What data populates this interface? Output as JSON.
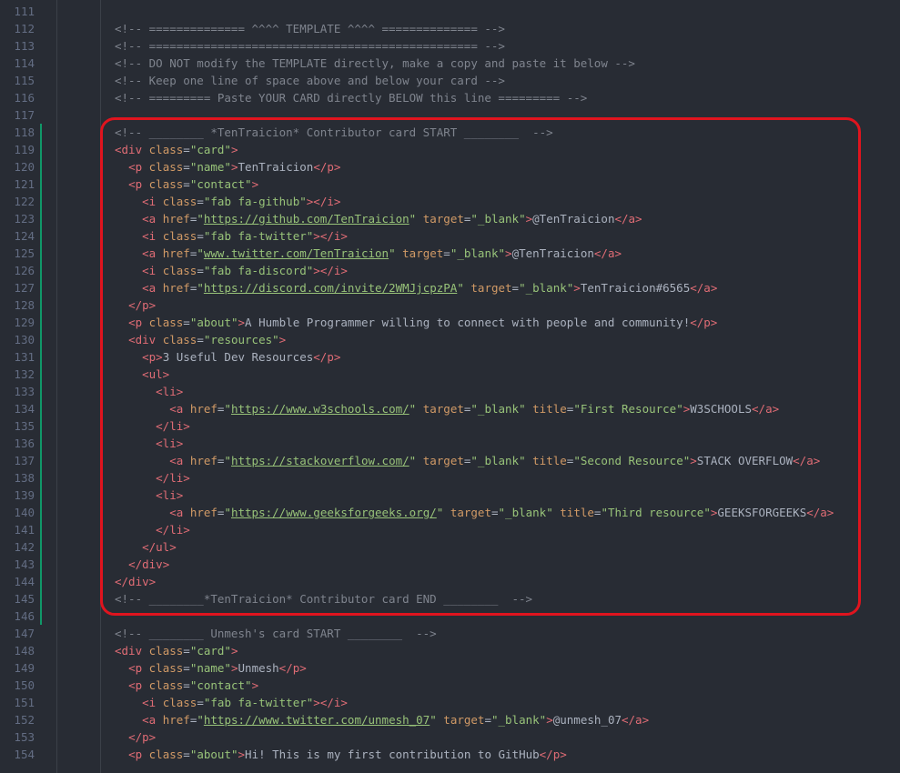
{
  "editor": {
    "lines": [
      {
        "n": "111",
        "mod": false,
        "parts": []
      },
      {
        "n": "112",
        "mod": false,
        "parts": [
          [
            "c",
            "<!-- ============== ^^^^ TEMPLATE ^^^^ ============== -->"
          ]
        ]
      },
      {
        "n": "113",
        "mod": false,
        "parts": [
          [
            "c",
            "<!-- ================================================ -->"
          ]
        ]
      },
      {
        "n": "114",
        "mod": false,
        "parts": [
          [
            "c",
            "<!-- DO NOT modify the TEMPLATE directly, make a copy and paste it below -->"
          ]
        ]
      },
      {
        "n": "115",
        "mod": false,
        "parts": [
          [
            "c",
            "<!-- Keep one line of space above and below your card -->"
          ]
        ]
      },
      {
        "n": "116",
        "mod": false,
        "parts": [
          [
            "c",
            "<!-- ========= Paste YOUR CARD directly BELOW this line ========= -->"
          ]
        ]
      },
      {
        "n": "117",
        "mod": false,
        "parts": []
      },
      {
        "n": "118",
        "mod": true,
        "parts": [
          [
            "c",
            "<!-- ________ *TenTraicion* Contributor card START ________  -->"
          ]
        ]
      },
      {
        "n": "119",
        "mod": true,
        "parts": [
          [
            "t",
            "<div"
          ],
          [
            "x",
            " "
          ],
          [
            "a",
            "class"
          ],
          [
            "p",
            "="
          ],
          [
            "s",
            "\"card\""
          ],
          [
            "t",
            ">"
          ]
        ]
      },
      {
        "n": "120",
        "mod": true,
        "parts": [
          [
            "x",
            "  "
          ],
          [
            "t",
            "<p"
          ],
          [
            "x",
            " "
          ],
          [
            "a",
            "class"
          ],
          [
            "p",
            "="
          ],
          [
            "s",
            "\"name\""
          ],
          [
            "t",
            ">"
          ],
          [
            "x",
            "TenTraicion"
          ],
          [
            "t",
            "</p>"
          ]
        ]
      },
      {
        "n": "121",
        "mod": true,
        "parts": [
          [
            "x",
            "  "
          ],
          [
            "t",
            "<p"
          ],
          [
            "x",
            " "
          ],
          [
            "a",
            "class"
          ],
          [
            "p",
            "="
          ],
          [
            "s",
            "\"contact\""
          ],
          [
            "t",
            ">"
          ]
        ]
      },
      {
        "n": "122",
        "mod": true,
        "parts": [
          [
            "x",
            "    "
          ],
          [
            "t",
            "<i"
          ],
          [
            "x",
            " "
          ],
          [
            "a",
            "class"
          ],
          [
            "p",
            "="
          ],
          [
            "s",
            "\"fab fa-github\""
          ],
          [
            "t",
            "></i>"
          ]
        ]
      },
      {
        "n": "123",
        "mod": true,
        "parts": [
          [
            "x",
            "    "
          ],
          [
            "t",
            "<a"
          ],
          [
            "x",
            " "
          ],
          [
            "a",
            "href"
          ],
          [
            "p",
            "="
          ],
          [
            "s",
            "\""
          ],
          [
            "u",
            "https://github.com/TenTraicion"
          ],
          [
            "s",
            "\""
          ],
          [
            "x",
            " "
          ],
          [
            "a",
            "target"
          ],
          [
            "p",
            "="
          ],
          [
            "s",
            "\"_blank\""
          ],
          [
            "t",
            ">"
          ],
          [
            "x",
            "@TenTraicion"
          ],
          [
            "t",
            "</a>"
          ]
        ]
      },
      {
        "n": "124",
        "mod": true,
        "parts": [
          [
            "x",
            "    "
          ],
          [
            "t",
            "<i"
          ],
          [
            "x",
            " "
          ],
          [
            "a",
            "class"
          ],
          [
            "p",
            "="
          ],
          [
            "s",
            "\"fab fa-twitter\""
          ],
          [
            "t",
            "></i>"
          ]
        ]
      },
      {
        "n": "125",
        "mod": true,
        "parts": [
          [
            "x",
            "    "
          ],
          [
            "t",
            "<a"
          ],
          [
            "x",
            " "
          ],
          [
            "a",
            "href"
          ],
          [
            "p",
            "="
          ],
          [
            "s",
            "\""
          ],
          [
            "u",
            "www.twitter.com/TenTraicion"
          ],
          [
            "s",
            "\""
          ],
          [
            "x",
            " "
          ],
          [
            "a",
            "target"
          ],
          [
            "p",
            "="
          ],
          [
            "s",
            "\"_blank\""
          ],
          [
            "t",
            ">"
          ],
          [
            "x",
            "@TenTraicion"
          ],
          [
            "t",
            "</a>"
          ]
        ]
      },
      {
        "n": "126",
        "mod": true,
        "parts": [
          [
            "x",
            "    "
          ],
          [
            "t",
            "<i"
          ],
          [
            "x",
            " "
          ],
          [
            "a",
            "class"
          ],
          [
            "p",
            "="
          ],
          [
            "s",
            "\"fab fa-discord\""
          ],
          [
            "t",
            "></i>"
          ]
        ]
      },
      {
        "n": "127",
        "mod": true,
        "parts": [
          [
            "x",
            "    "
          ],
          [
            "t",
            "<a"
          ],
          [
            "x",
            " "
          ],
          [
            "a",
            "href"
          ],
          [
            "p",
            "="
          ],
          [
            "s",
            "\""
          ],
          [
            "u",
            "https://discord.com/invite/2WMJjcpzPA"
          ],
          [
            "s",
            "\""
          ],
          [
            "x",
            " "
          ],
          [
            "a",
            "target"
          ],
          [
            "p",
            "="
          ],
          [
            "s",
            "\"_blank\""
          ],
          [
            "t",
            ">"
          ],
          [
            "x",
            "TenTraicion#6565"
          ],
          [
            "t",
            "</a>"
          ]
        ]
      },
      {
        "n": "128",
        "mod": true,
        "parts": [
          [
            "x",
            "  "
          ],
          [
            "t",
            "</p>"
          ]
        ]
      },
      {
        "n": "129",
        "mod": true,
        "parts": [
          [
            "x",
            "  "
          ],
          [
            "t",
            "<p"
          ],
          [
            "x",
            " "
          ],
          [
            "a",
            "class"
          ],
          [
            "p",
            "="
          ],
          [
            "s",
            "\"about\""
          ],
          [
            "t",
            ">"
          ],
          [
            "x",
            "A Humble Programmer willing to connect with people and community!"
          ],
          [
            "t",
            "</p>"
          ]
        ]
      },
      {
        "n": "130",
        "mod": true,
        "parts": [
          [
            "x",
            "  "
          ],
          [
            "t",
            "<div"
          ],
          [
            "x",
            " "
          ],
          [
            "a",
            "class"
          ],
          [
            "p",
            "="
          ],
          [
            "s",
            "\"resources\""
          ],
          [
            "t",
            ">"
          ]
        ]
      },
      {
        "n": "131",
        "mod": true,
        "parts": [
          [
            "x",
            "    "
          ],
          [
            "t",
            "<p>"
          ],
          [
            "x",
            "3 Useful Dev Resources"
          ],
          [
            "t",
            "</p>"
          ]
        ]
      },
      {
        "n": "132",
        "mod": true,
        "parts": [
          [
            "x",
            "    "
          ],
          [
            "t",
            "<ul>"
          ]
        ]
      },
      {
        "n": "133",
        "mod": true,
        "parts": [
          [
            "x",
            "      "
          ],
          [
            "t",
            "<li>"
          ]
        ]
      },
      {
        "n": "134",
        "mod": true,
        "parts": [
          [
            "x",
            "        "
          ],
          [
            "t",
            "<a"
          ],
          [
            "x",
            " "
          ],
          [
            "a",
            "href"
          ],
          [
            "p",
            "="
          ],
          [
            "s",
            "\""
          ],
          [
            "u",
            "https://www.w3schools.com/"
          ],
          [
            "s",
            "\""
          ],
          [
            "x",
            " "
          ],
          [
            "a",
            "target"
          ],
          [
            "p",
            "="
          ],
          [
            "s",
            "\"_blank\""
          ],
          [
            "x",
            " "
          ],
          [
            "a",
            "title"
          ],
          [
            "p",
            "="
          ],
          [
            "s",
            "\"First Resource\""
          ],
          [
            "t",
            ">"
          ],
          [
            "x",
            "W3SCHOOLS"
          ],
          [
            "t",
            "</a>"
          ]
        ]
      },
      {
        "n": "135",
        "mod": true,
        "parts": [
          [
            "x",
            "      "
          ],
          [
            "t",
            "</li>"
          ]
        ]
      },
      {
        "n": "136",
        "mod": true,
        "parts": [
          [
            "x",
            "      "
          ],
          [
            "t",
            "<li>"
          ]
        ]
      },
      {
        "n": "137",
        "mod": true,
        "parts": [
          [
            "x",
            "        "
          ],
          [
            "t",
            "<a"
          ],
          [
            "x",
            " "
          ],
          [
            "a",
            "href"
          ],
          [
            "p",
            "="
          ],
          [
            "s",
            "\""
          ],
          [
            "u",
            "https://stackoverflow.com/"
          ],
          [
            "s",
            "\""
          ],
          [
            "x",
            " "
          ],
          [
            "a",
            "target"
          ],
          [
            "p",
            "="
          ],
          [
            "s",
            "\"_blank\""
          ],
          [
            "x",
            " "
          ],
          [
            "a",
            "title"
          ],
          [
            "p",
            "="
          ],
          [
            "s",
            "\"Second Resource\""
          ],
          [
            "t",
            ">"
          ],
          [
            "x",
            "STACK OVERFLOW"
          ],
          [
            "t",
            "</a>"
          ]
        ]
      },
      {
        "n": "138",
        "mod": true,
        "parts": [
          [
            "x",
            "      "
          ],
          [
            "t",
            "</li>"
          ]
        ]
      },
      {
        "n": "139",
        "mod": true,
        "parts": [
          [
            "x",
            "      "
          ],
          [
            "t",
            "<li>"
          ]
        ]
      },
      {
        "n": "140",
        "mod": true,
        "parts": [
          [
            "x",
            "        "
          ],
          [
            "t",
            "<a"
          ],
          [
            "x",
            " "
          ],
          [
            "a",
            "href"
          ],
          [
            "p",
            "="
          ],
          [
            "s",
            "\""
          ],
          [
            "u",
            "https://www.geeksforgeeks.org/"
          ],
          [
            "s",
            "\""
          ],
          [
            "x",
            " "
          ],
          [
            "a",
            "target"
          ],
          [
            "p",
            "="
          ],
          [
            "s",
            "\"_blank\""
          ],
          [
            "x",
            " "
          ],
          [
            "a",
            "title"
          ],
          [
            "p",
            "="
          ],
          [
            "s",
            "\"Third resource\""
          ],
          [
            "t",
            ">"
          ],
          [
            "x",
            "GEEKSFORGEEKS"
          ],
          [
            "t",
            "</a>"
          ]
        ]
      },
      {
        "n": "141",
        "mod": true,
        "parts": [
          [
            "x",
            "      "
          ],
          [
            "t",
            "</li>"
          ]
        ]
      },
      {
        "n": "142",
        "mod": true,
        "parts": [
          [
            "x",
            "    "
          ],
          [
            "t",
            "</ul>"
          ]
        ]
      },
      {
        "n": "143",
        "mod": true,
        "parts": [
          [
            "x",
            "  "
          ],
          [
            "t",
            "</div>"
          ]
        ]
      },
      {
        "n": "144",
        "mod": true,
        "parts": [
          [
            "t",
            "</div>"
          ]
        ]
      },
      {
        "n": "145",
        "mod": true,
        "parts": [
          [
            "c",
            "<!-- ________*TenTraicion* Contributor card END ________  -->"
          ]
        ]
      },
      {
        "n": "146",
        "mod": true,
        "parts": []
      },
      {
        "n": "147",
        "mod": false,
        "parts": [
          [
            "c",
            "<!-- ________ Unmesh's card START ________  -->"
          ]
        ]
      },
      {
        "n": "148",
        "mod": false,
        "parts": [
          [
            "t",
            "<div"
          ],
          [
            "x",
            " "
          ],
          [
            "a",
            "class"
          ],
          [
            "p",
            "="
          ],
          [
            "s",
            "\"card\""
          ],
          [
            "t",
            ">"
          ]
        ]
      },
      {
        "n": "149",
        "mod": false,
        "parts": [
          [
            "x",
            "  "
          ],
          [
            "t",
            "<p"
          ],
          [
            "x",
            " "
          ],
          [
            "a",
            "class"
          ],
          [
            "p",
            "="
          ],
          [
            "s",
            "\"name\""
          ],
          [
            "t",
            ">"
          ],
          [
            "x",
            "Unmesh"
          ],
          [
            "t",
            "</p>"
          ]
        ]
      },
      {
        "n": "150",
        "mod": false,
        "parts": [
          [
            "x",
            "  "
          ],
          [
            "t",
            "<p"
          ],
          [
            "x",
            " "
          ],
          [
            "a",
            "class"
          ],
          [
            "p",
            "="
          ],
          [
            "s",
            "\"contact\""
          ],
          [
            "t",
            ">"
          ]
        ]
      },
      {
        "n": "151",
        "mod": false,
        "parts": [
          [
            "x",
            "    "
          ],
          [
            "t",
            "<i"
          ],
          [
            "x",
            " "
          ],
          [
            "a",
            "class"
          ],
          [
            "p",
            "="
          ],
          [
            "s",
            "\"fab fa-twitter\""
          ],
          [
            "t",
            "></i>"
          ]
        ]
      },
      {
        "n": "152",
        "mod": false,
        "parts": [
          [
            "x",
            "    "
          ],
          [
            "t",
            "<a"
          ],
          [
            "x",
            " "
          ],
          [
            "a",
            "href"
          ],
          [
            "p",
            "="
          ],
          [
            "s",
            "\""
          ],
          [
            "u",
            "https://www.twitter.com/unmesh_07"
          ],
          [
            "s",
            "\""
          ],
          [
            "x",
            " "
          ],
          [
            "a",
            "target"
          ],
          [
            "p",
            "="
          ],
          [
            "s",
            "\"_blank\""
          ],
          [
            "t",
            ">"
          ],
          [
            "x",
            "@unmesh_07"
          ],
          [
            "t",
            "</a>"
          ]
        ]
      },
      {
        "n": "153",
        "mod": false,
        "parts": [
          [
            "x",
            "  "
          ],
          [
            "t",
            "</p>"
          ]
        ]
      },
      {
        "n": "154",
        "mod": false,
        "parts": [
          [
            "x",
            "  "
          ],
          [
            "t",
            "<p"
          ],
          [
            "x",
            " "
          ],
          [
            "a",
            "class"
          ],
          [
            "p",
            "="
          ],
          [
            "s",
            "\"about\""
          ],
          [
            "t",
            ">"
          ],
          [
            "x",
            "Hi! This is my first contribution to GitHub"
          ],
          [
            "t",
            "</p>"
          ]
        ]
      }
    ]
  }
}
